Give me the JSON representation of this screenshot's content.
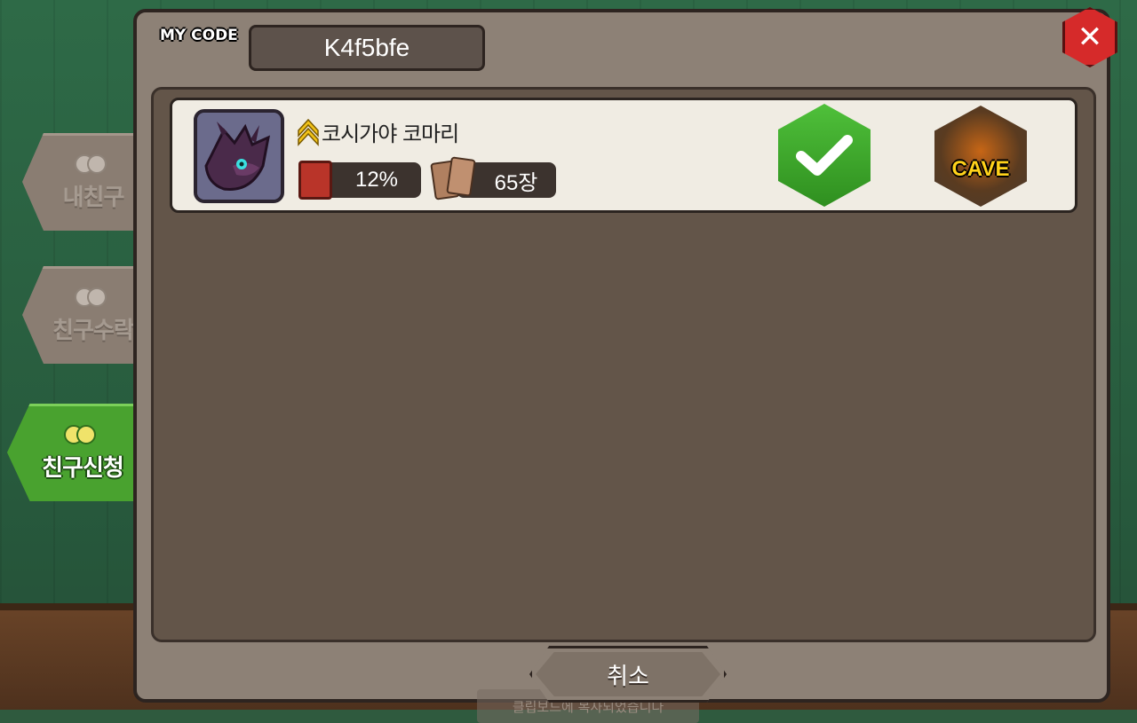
{
  "header": {
    "mycode_label": "MY CODE",
    "mycode_value": "K4f5bfe"
  },
  "tabs": [
    {
      "label": "내친구",
      "active": false
    },
    {
      "label": "친구수락",
      "active": false
    },
    {
      "label": "친구신청",
      "active": true
    }
  ],
  "friend_requests": [
    {
      "name": "코시가야 코마리",
      "collection_percent": "12%",
      "card_count": "65장",
      "accept_icon": "checkmark-icon",
      "cave_label": "CAVE"
    }
  ],
  "toast": "클립보드에 복사되었습니다",
  "footer": {
    "cancel_label": "취소"
  },
  "colors": {
    "panel": "#8d8176",
    "list_bg": "#635549",
    "accept_green": "#3faa2b",
    "close_red": "#d62a2a",
    "cave_yellow": "#ffd21a"
  }
}
